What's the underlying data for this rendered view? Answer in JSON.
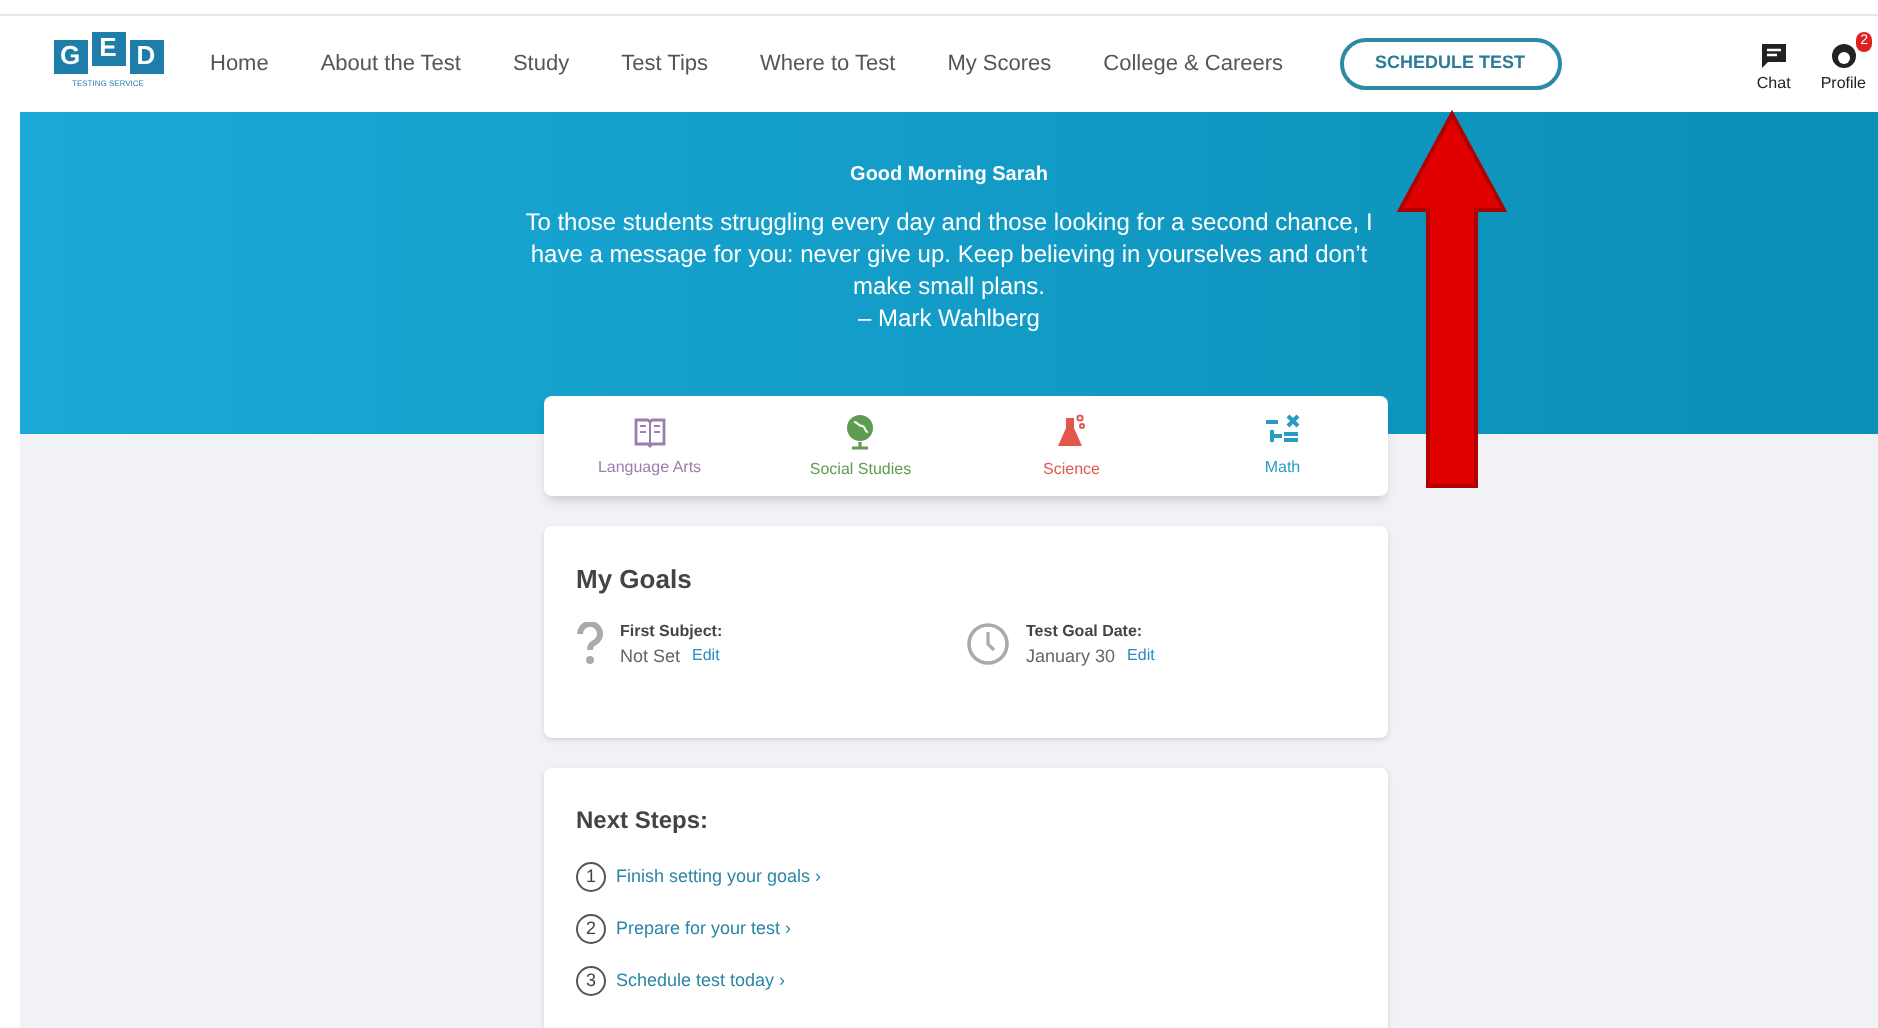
{
  "logo": {
    "letters": [
      "G",
      "E",
      "D"
    ],
    "tagline": "TESTING SERVICE"
  },
  "nav": [
    {
      "label": "Home"
    },
    {
      "label": "About the Test"
    },
    {
      "label": "Study"
    },
    {
      "label": "Test Tips"
    },
    {
      "label": "Where to Test"
    },
    {
      "label": "My Scores"
    },
    {
      "label": "College & Careers"
    }
  ],
  "cta": "SCHEDULE TEST",
  "actions": [
    {
      "kind": "chat",
      "label": "Chat"
    },
    {
      "kind": "profile",
      "label": "Profile",
      "badge": "2"
    }
  ],
  "hero": {
    "greeting": "Good Morning Sarah",
    "quote": "To those students struggling every day and those looking for a second chance, I have a message for you: never give up. Keep believing in yourselves and don’t make small plans.",
    "author": "– Mark Wahlberg"
  },
  "subjects": [
    {
      "kind": "book",
      "label": "Language Arts",
      "color": "#9b7fb0"
    },
    {
      "kind": "globe",
      "label": "Social Studies",
      "color": "#5e9c4f"
    },
    {
      "kind": "flask",
      "label": "Science",
      "color": "#e2574c"
    },
    {
      "kind": "math",
      "label": "Math",
      "color": "#2a9bc4"
    }
  ],
  "goals": {
    "title": "My Goals",
    "items": [
      {
        "kind": "question",
        "label": "First Subject:",
        "value": "Not Set",
        "link": "Edit"
      },
      {
        "kind": "clock",
        "label": "Test Goal Date:",
        "value": "January 30",
        "link": "Edit"
      }
    ]
  },
  "next_steps": {
    "title": "Next Steps:",
    "items": [
      {
        "number": "1",
        "label": "Finish setting your goals ›"
      },
      {
        "number": "2",
        "label": "Prepare for your test ›"
      },
      {
        "number": "3",
        "label": "Schedule test today ›"
      }
    ]
  },
  "annotation": {
    "kind": "arrow",
    "color": "#e00000"
  }
}
